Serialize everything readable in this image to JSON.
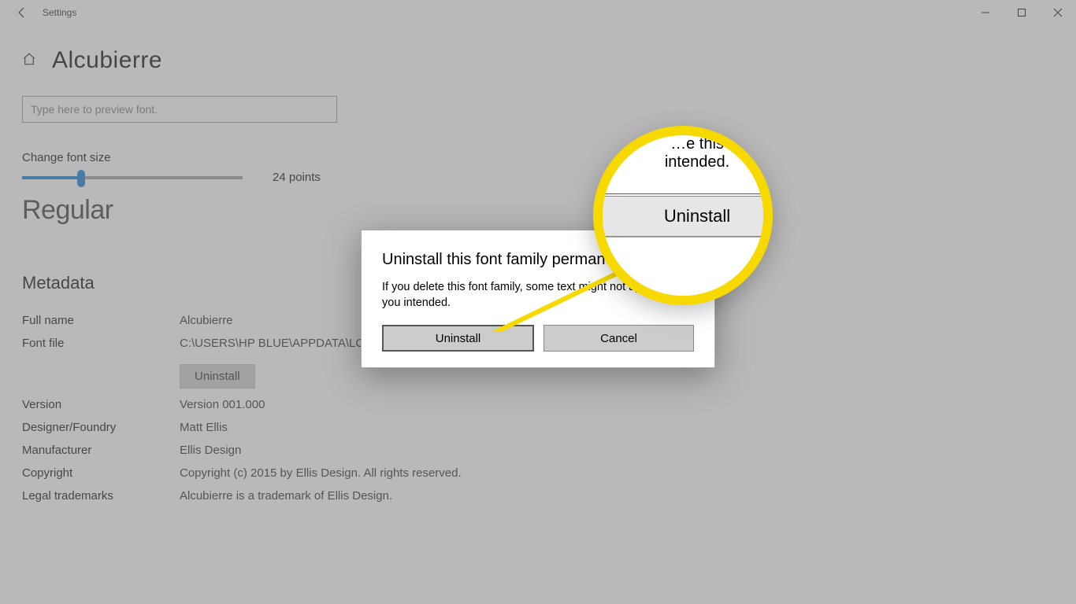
{
  "titlebar": {
    "app_title": "Settings"
  },
  "page": {
    "title": "Alcubierre",
    "preview_placeholder": "Type here to preview font.",
    "size_label": "Change font size",
    "size_value": "24 points",
    "sample_text": "Regular",
    "metadata_title": "Metadata"
  },
  "metadata": {
    "rows": [
      {
        "key": "Full name",
        "val": "Alcubierre"
      },
      {
        "key": "Font file",
        "val": "C:\\USERS\\HP BLUE\\APPDATA\\LOCAL\\MICROSOFT\\WINDOWS\\FONTS\\ALCUBIERRE.OTF"
      },
      {
        "key": "",
        "val": ""
      },
      {
        "key": "Version",
        "val": "Version 001.000"
      },
      {
        "key": "Designer/Foundry",
        "val": "Matt Ellis"
      },
      {
        "key": "Manufacturer",
        "val": "Ellis Design"
      },
      {
        "key": "Copyright",
        "val": "Copyright (c) 2015 by Ellis Design. All rights reserved."
      },
      {
        "key": "Legal trademarks",
        "val": "Alcubierre is a trademark of Ellis Design."
      }
    ],
    "uninstall_label": "Uninstall"
  },
  "dialog": {
    "title": "Uninstall this font family permanently?",
    "body": "If you delete this font family, some text might not appear as you intended.",
    "uninstall": "Uninstall",
    "cancel": "Cancel"
  },
  "callout": {
    "line1": "…e this",
    "line2": "intended.",
    "button": "Uninstall"
  }
}
